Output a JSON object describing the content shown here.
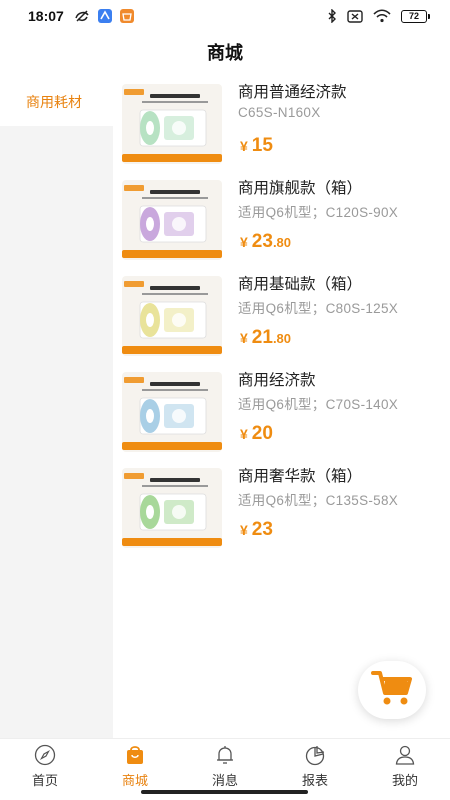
{
  "status_bar": {
    "time": "18:07",
    "battery": "72"
  },
  "header": {
    "title": "商城"
  },
  "sidebar": {
    "items": [
      {
        "label": "商用耗材",
        "selected": true
      }
    ]
  },
  "products": [
    {
      "name": "商用普通经济款",
      "subtitle": "C65S-N160X",
      "price_int": "15",
      "price_dec": "",
      "accent": "#b7e2c3"
    },
    {
      "name": "商用旗舰款（箱）",
      "subtitle": "适用Q6机型；C120S-90X",
      "price_int": "23",
      "price_dec": ".80",
      "accent": "#c9a8dd"
    },
    {
      "name": "商用基础款（箱）",
      "subtitle": "适用Q6机型；C80S-125X",
      "price_int": "21",
      "price_dec": ".80",
      "accent": "#e9e39a"
    },
    {
      "name": "商用经济款",
      "subtitle": "适用Q6机型；C70S-140X",
      "price_int": "20",
      "price_dec": "",
      "accent": "#a9cfe6"
    },
    {
      "name": "商用奢华款（箱）",
      "subtitle": "适用Q6机型；C135S-58X",
      "price_int": "23",
      "price_dec": "",
      "accent": "#a8d89a"
    }
  ],
  "currency_symbol": "¥",
  "nav": [
    {
      "label": "首页",
      "icon": "compass-icon",
      "active": false
    },
    {
      "label": "商城",
      "icon": "shopping-bag-icon",
      "active": true
    },
    {
      "label": "消息",
      "icon": "bell-icon",
      "active": false
    },
    {
      "label": "报表",
      "icon": "pie-chart-icon",
      "active": false
    },
    {
      "label": "我的",
      "icon": "user-icon",
      "active": false
    }
  ],
  "colors": {
    "accent": "#ef8c11",
    "sidebar_bg": "#f4f4f4",
    "muted_text": "#9a9a9a"
  }
}
